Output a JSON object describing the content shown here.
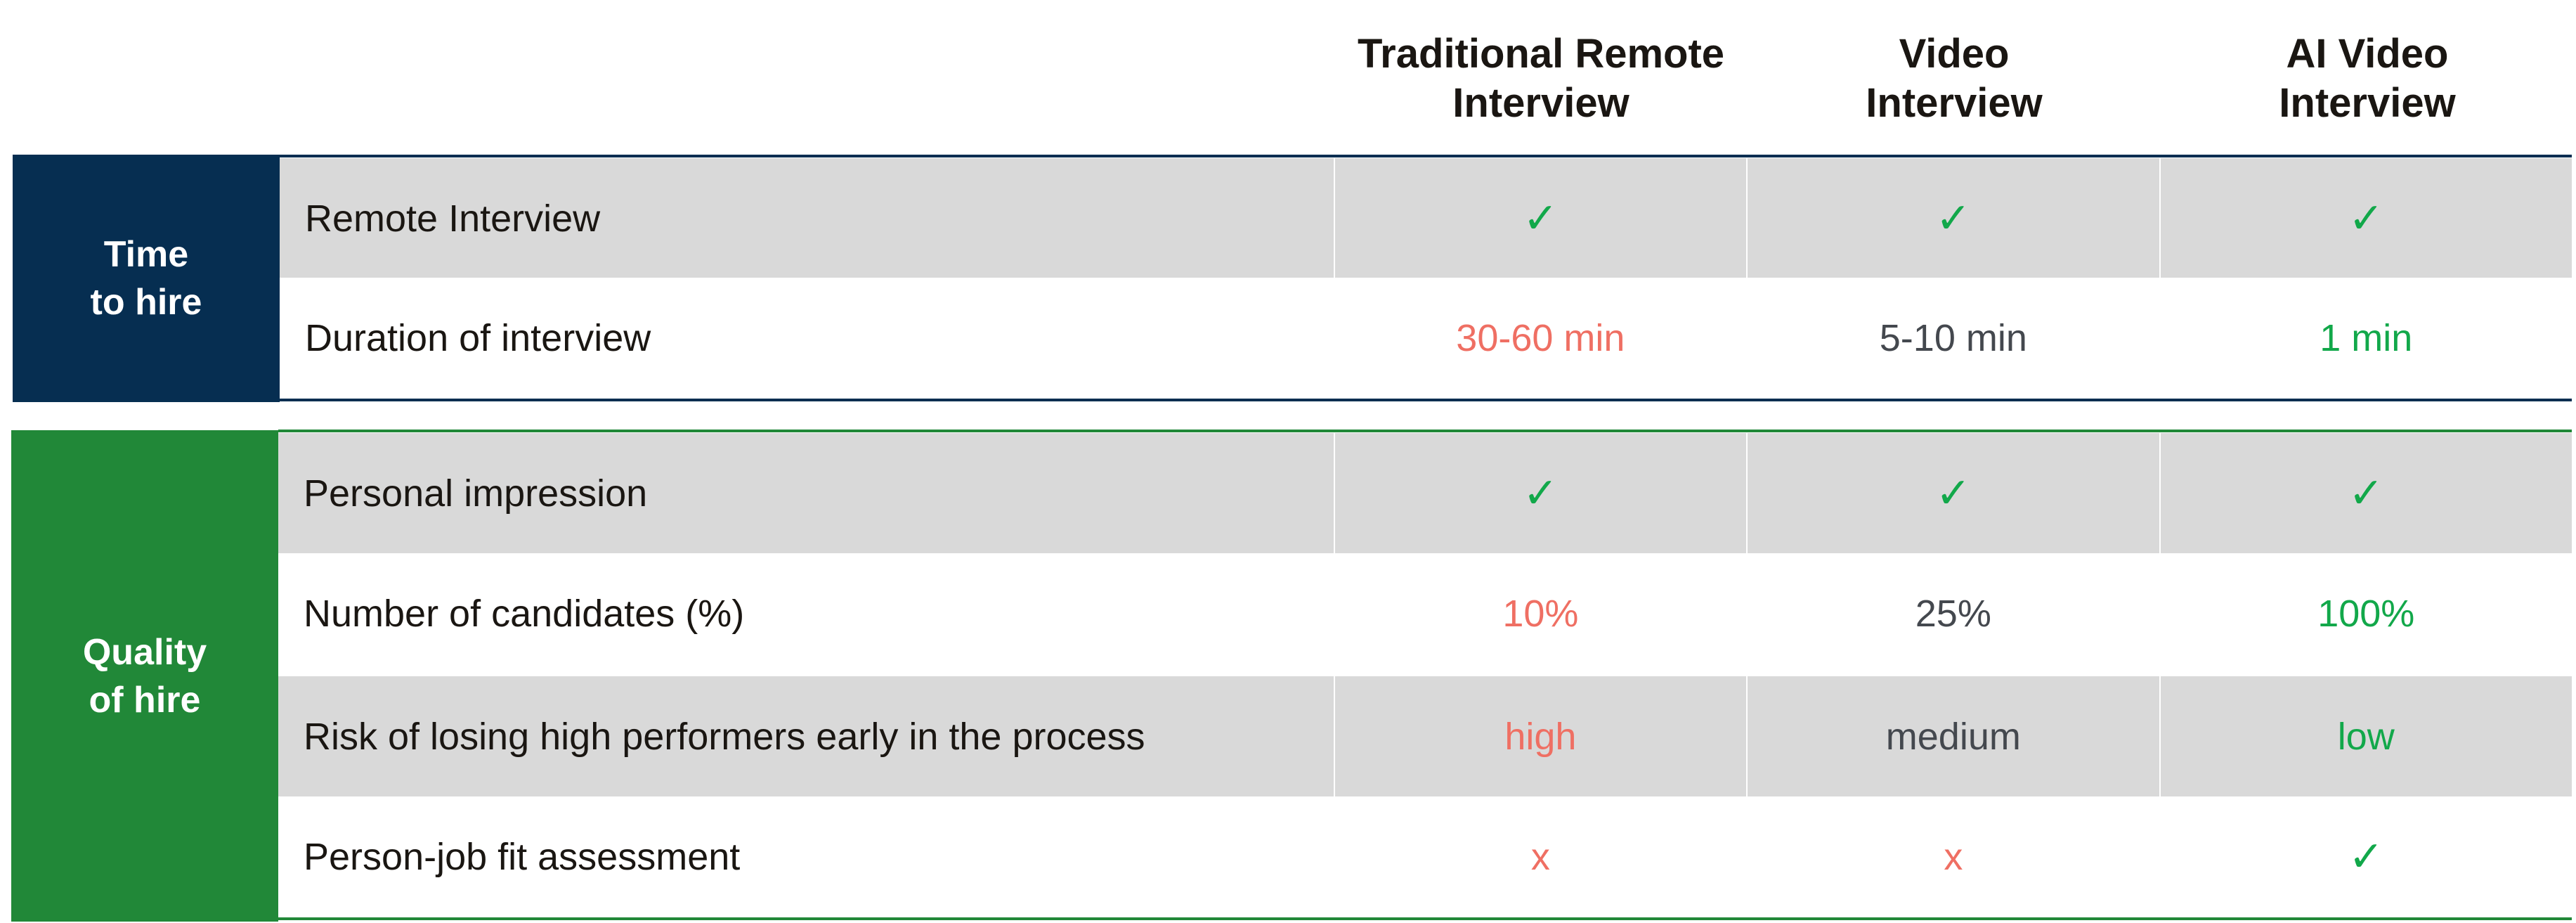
{
  "colors": {
    "time_section": "#062e51",
    "quality_section": "#218838",
    "shaded_row": "#d9d9d9",
    "good": "#12a84a",
    "bad": "#ef6f63",
    "neutral": "#44484e"
  },
  "columns": [
    {
      "label": "Traditional Remote\nInterview"
    },
    {
      "label": "Video\nInterview"
    },
    {
      "label": "AI Video\nInterview"
    }
  ],
  "sections": [
    {
      "label": "Time\nto hire",
      "rows": [
        {
          "label": "Remote Interview",
          "values": [
            {
              "text": "✓",
              "icon": "check-icon",
              "tone": "good"
            },
            {
              "text": "✓",
              "icon": "check-icon",
              "tone": "good"
            },
            {
              "text": "✓",
              "icon": "check-icon",
              "tone": "good"
            }
          ]
        },
        {
          "label": "Duration of interview",
          "values": [
            {
              "text": "30-60 min",
              "tone": "bad"
            },
            {
              "text": "5-10 min",
              "tone": "neutral"
            },
            {
              "text": "1 min",
              "tone": "good"
            }
          ]
        }
      ]
    },
    {
      "label": "Quality\nof hire",
      "rows": [
        {
          "label": "Personal impression",
          "values": [
            {
              "text": "✓",
              "icon": "check-icon",
              "tone": "good"
            },
            {
              "text": "✓",
              "icon": "check-icon",
              "tone": "good"
            },
            {
              "text": "✓",
              "icon": "check-icon",
              "tone": "good"
            }
          ]
        },
        {
          "label": "Number of candidates (%)",
          "values": [
            {
              "text": "10%",
              "tone": "bad"
            },
            {
              "text": "25%",
              "tone": "neutral"
            },
            {
              "text": "100%",
              "tone": "good"
            }
          ]
        },
        {
          "label": "Risk of losing high performers early in the process",
          "values": [
            {
              "text": "high",
              "tone": "bad"
            },
            {
              "text": "medium",
              "tone": "neutral"
            },
            {
              "text": "low",
              "tone": "good"
            }
          ]
        },
        {
          "label": "Person-job fit assessment",
          "values": [
            {
              "text": "x",
              "icon": "cross-icon",
              "tone": "bad"
            },
            {
              "text": "x",
              "icon": "cross-icon",
              "tone": "bad"
            },
            {
              "text": "✓",
              "icon": "check-icon",
              "tone": "good"
            }
          ]
        }
      ]
    }
  ]
}
